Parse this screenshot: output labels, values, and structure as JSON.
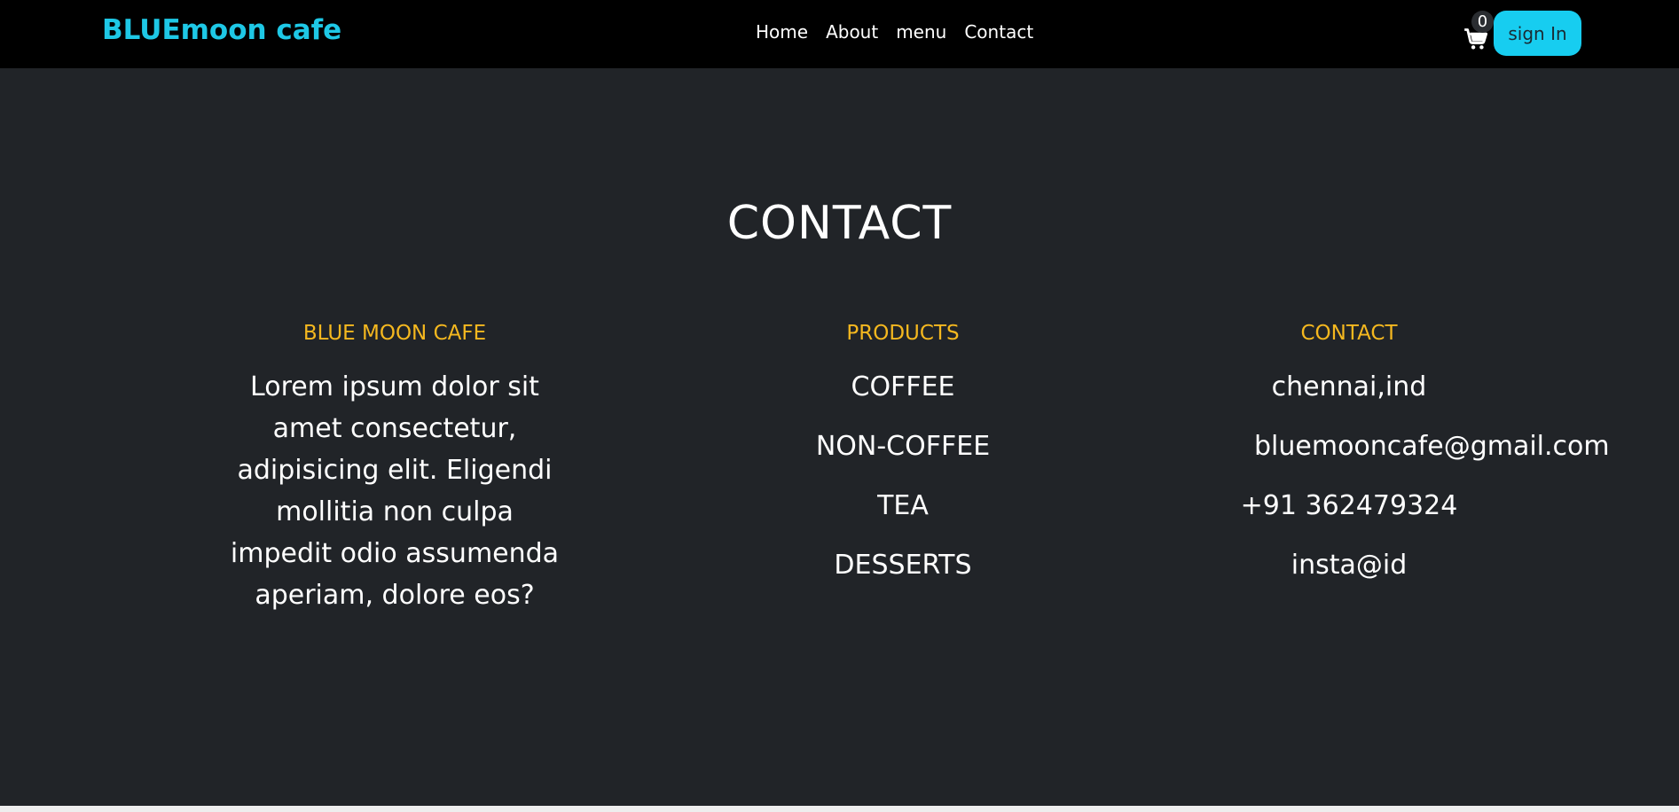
{
  "header": {
    "brand": "BLUEmoon cafe",
    "nav": [
      "Home",
      "About",
      "menu",
      "Contact"
    ],
    "cart_count": "0",
    "signin_label": "sign In"
  },
  "contact_section": {
    "title": "CONTACT",
    "about": {
      "heading": "BLUE MOON CAFE",
      "text": "Lorem ipsum dolor sit amet consectetur, adipisicing elit. Eligendi mollitia non culpa impedit odio assumenda aperiam, dolore eos?"
    },
    "products": {
      "heading": "PRODUCTS",
      "items": [
        "COFFEE",
        "NON-COFFEE",
        "TEA",
        "DESSERTS"
      ]
    },
    "contact": {
      "heading": "CONTACT",
      "items": [
        "chennai,ind",
        "bluemooncafe@gmail.com",
        "+91 362479324",
        "insta@id"
      ]
    }
  },
  "colors": {
    "navbar_bg": "#000000",
    "brand": "#1ec8e6",
    "section_bg": "#212428",
    "heading_accent": "#f5b81f",
    "signin_bg": "#17cdf0"
  },
  "icons": {
    "cart": "shopping-cart-icon"
  }
}
